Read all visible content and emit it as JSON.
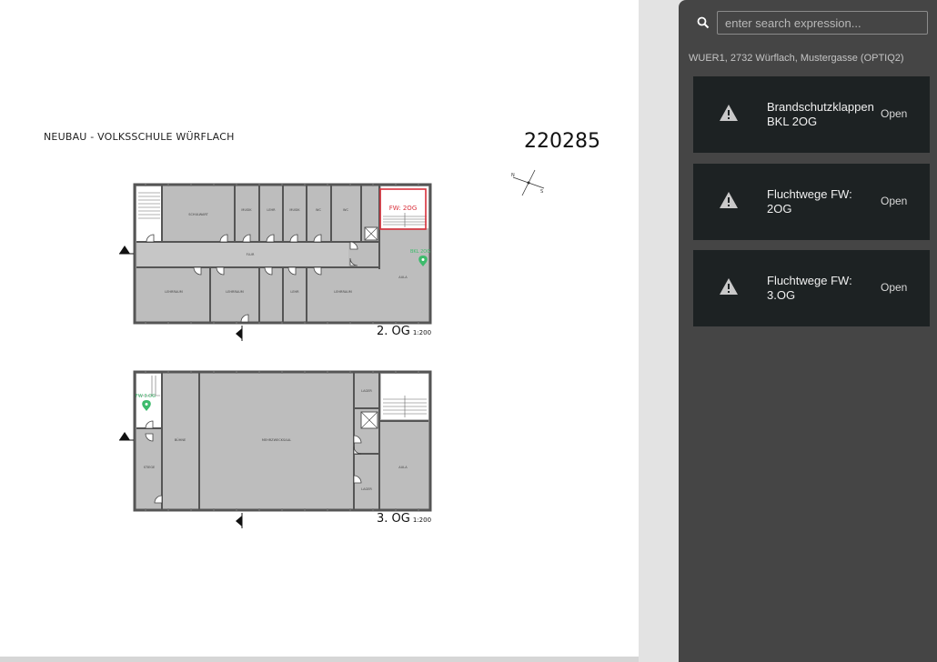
{
  "document": {
    "project_title": "NEUBAU   - VOLKSSCHULE WÜRFLACH",
    "project_number": "220285",
    "floors": [
      {
        "label": "2. OG",
        "scale": "1:200",
        "highlight_label": "FW: 2OG",
        "marker_label": "BKL 2OG",
        "rooms": [
          "SCHULWART",
          "MUSIK",
          "LEHR",
          "MUSIK",
          "WC",
          "WC",
          "LEHRRAUM",
          "LEHRRAUM",
          "FLUR",
          "LEHRRAUM",
          "LEHR",
          "AULA"
        ]
      },
      {
        "label": "3. OG",
        "scale": "1:200",
        "marker_label": "FW 3.OG",
        "rooms": [
          "STIEGE",
          "BÜHNE",
          "MEHRZWECKSAAL",
          "LAGER",
          "AULA",
          "LAGER"
        ]
      }
    ]
  },
  "search": {
    "placeholder": "enter search expression..."
  },
  "location": "WUER1, 2732 Würflach, Mustergasse (OPTIQ2)",
  "tasks": [
    {
      "title": "Brandschutzklappen BKL 2OG",
      "status": "Open",
      "icon": "warning-icon"
    },
    {
      "title": "Fluchtwege FW: 2OG",
      "status": "Open",
      "icon": "warning-icon"
    },
    {
      "title": "Fluchtwege FW: 3.OG",
      "status": "Open",
      "icon": "warning-icon"
    }
  ],
  "colors": {
    "panel_bg": "#454545",
    "card_bg": "#1d2223",
    "highlight": "#d9303b",
    "marker": "#3dbb6c",
    "room_fill": "#bdbdbd",
    "wall": "#555555"
  }
}
